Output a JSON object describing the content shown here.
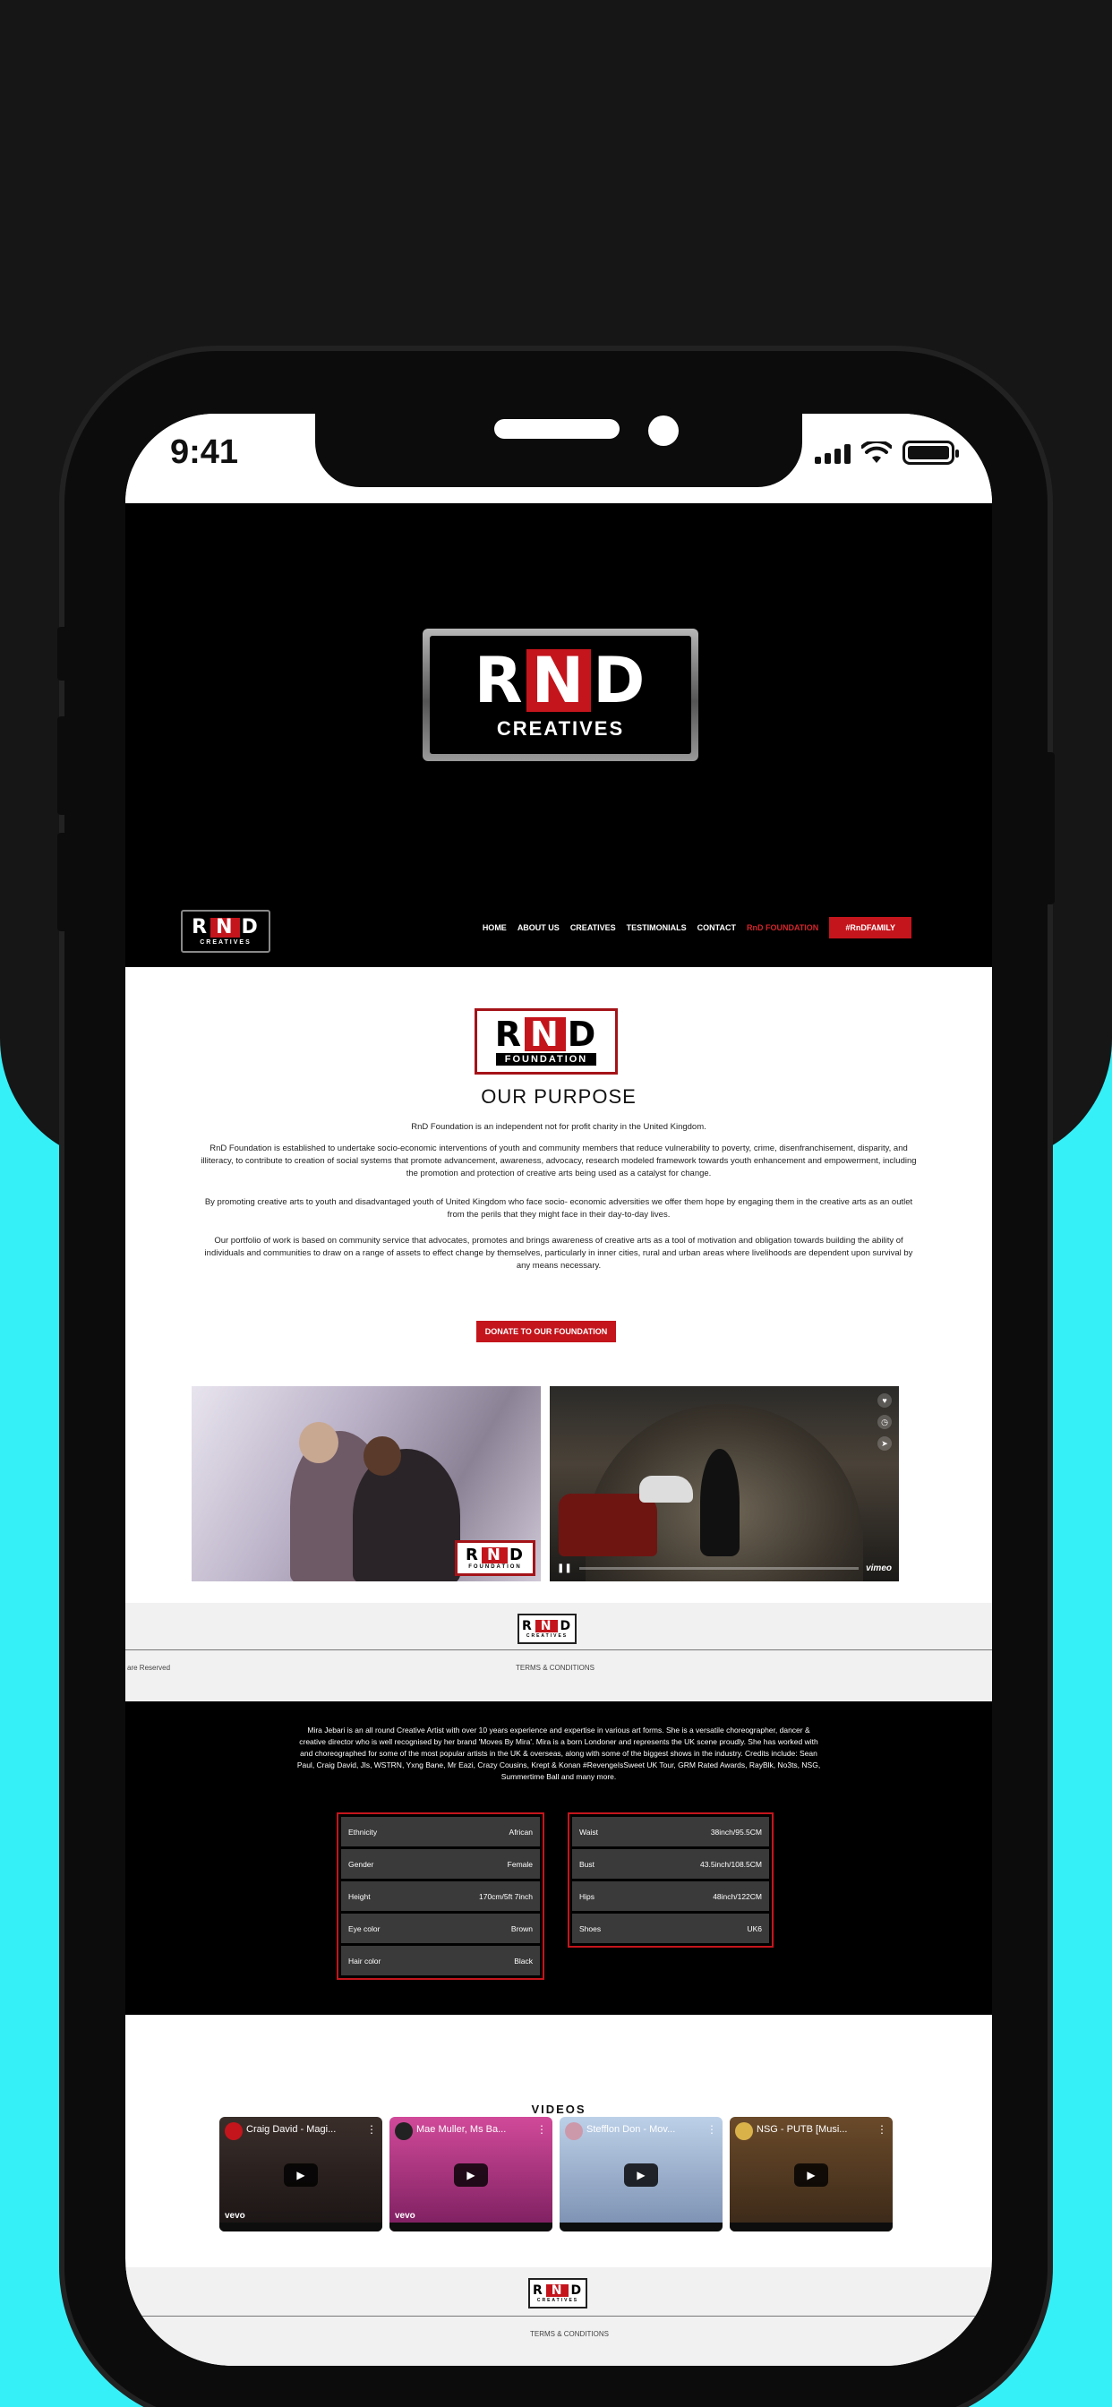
{
  "status_bar": {
    "time": "9:41"
  },
  "brand": {
    "logo_main_letters": [
      "R",
      "N",
      "D"
    ],
    "logo_main_sub": "CREATIVES",
    "logo_foundation_sub": "FOUNDATION",
    "brand_red": "#c4151c",
    "background_cyan": "#36f0f8"
  },
  "nav": {
    "items": [
      "HOME",
      "ABOUT US",
      "CREATIVES",
      "TESTIMONIALS",
      "CONTACT",
      "RnD FOUNDATION"
    ],
    "active_item": "RnD FOUNDATION",
    "cta": "#RnDFAMILY"
  },
  "purpose": {
    "title": "OUR PURPOSE",
    "intro": "RnD Foundation is an independent not for profit charity in the United Kingdom.",
    "p1": "RnD Foundation is established to undertake socio-economic interventions of youth and community members that reduce vulnerability to poverty, crime, disenfranchisement, disparity, and illiteracy, to contribute to creation of social systems that promote advancement, awareness, advocacy, research modeled framework towards youth enhancement and empowerment, including the promotion and protection of creative arts being used as a catalyst for change.",
    "p2": "By promoting creative arts to youth and disadvantaged youth of United Kingdom who face socio- economic adversities we offer them hope by engaging them in the creative arts as an outlet from the perils that they might face in their day-to-day lives.",
    "p3": "Our portfolio of work is based on community service that advocates, promotes and brings awareness of creative arts as a tool of motivation and obligation towards building the ability of individuals and communities to draw on a range of assets to effect change by themselves, particularly in inner cities, rural and urban areas where livelihoods are dependent upon survival by any means necessary.",
    "donate_button": "DONATE TO OUR FOUNDATION"
  },
  "media": {
    "video_brand": "vimeo"
  },
  "footer": {
    "rights_fragment": "are Reserved",
    "terms": "TERMS & CONDITIONS",
    "rights_fragment_2": "d"
  },
  "profile": {
    "bio": "Mira Jebari is an all round Creative Artist with over 10 years experience and expertise in various art forms. She is a versatile choreographer, dancer & creative director who is well recognised by her brand 'Moves By Mira'. Mira is a born Londoner and represents the UK scene proudly. She has worked with and choreographed for some of the most popular artists in the UK & overseas, along with some of the biggest shows in the industry. Credits include: Sean Paul, Craig David, Jls, WSTRN, Yxng Bane, Mr Eazi, Crazy Cousins, Krept & Konan #RevengeIsSweet UK Tour, GRM Rated Awards, RayBlk, No3ts, NSG, Summertime Ball and many more.",
    "stats_left": [
      {
        "label": "Ethnicity",
        "value": "African"
      },
      {
        "label": "Gender",
        "value": "Female"
      },
      {
        "label": "Height",
        "value": "170cm/5ft 7inch"
      },
      {
        "label": "Eye color",
        "value": "Brown"
      },
      {
        "label": "Hair color",
        "value": "Black"
      }
    ],
    "stats_right": [
      {
        "label": "Waist",
        "value": "38inch/95.5CM"
      },
      {
        "label": "Bust",
        "value": "43.5inch/108.5CM"
      },
      {
        "label": "Hips",
        "value": "48inch/122CM"
      },
      {
        "label": "Shoes",
        "value": "UK6"
      }
    ]
  },
  "videos": {
    "title": "VIDEOS",
    "items": [
      {
        "title": "Craig David - Magi...",
        "badge": "vevo"
      },
      {
        "title": "Mae Muller, Ms Ba...",
        "badge": "vevo"
      },
      {
        "title": "Stefflon Don - Mov...",
        "badge": ""
      },
      {
        "title": "NSG - PUTB [Musi...",
        "badge": ""
      }
    ]
  }
}
